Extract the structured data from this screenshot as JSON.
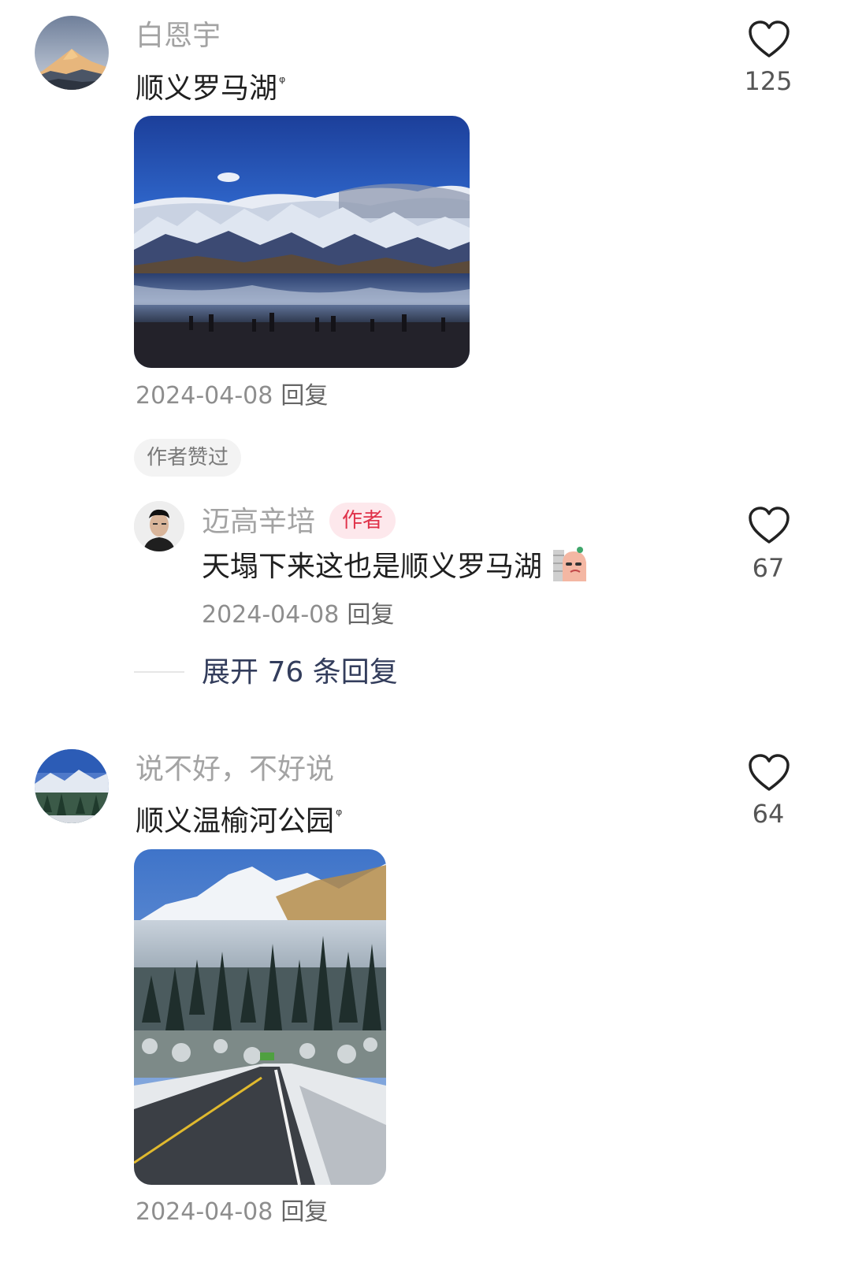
{
  "comment1": {
    "username": "白恩宇",
    "content": "顺义罗马湖",
    "search_mark": "ᵠ",
    "date": "2024-04-08",
    "reply": "回复",
    "likes": "125",
    "liked_tag": "作者赞过"
  },
  "reply1": {
    "username": "迈高辛培",
    "badge": "作者",
    "content": "天塌下来这也是顺义罗马湖",
    "date": "2024-04-08",
    "reply": "回复",
    "likes": "67",
    "expand": "展开 76 条回复"
  },
  "comment2": {
    "username": "说不好，不好说",
    "content": "顺义温榆河公园",
    "search_mark": "ᵠ",
    "date": "2024-04-08",
    "reply": "回复",
    "likes": "64"
  }
}
